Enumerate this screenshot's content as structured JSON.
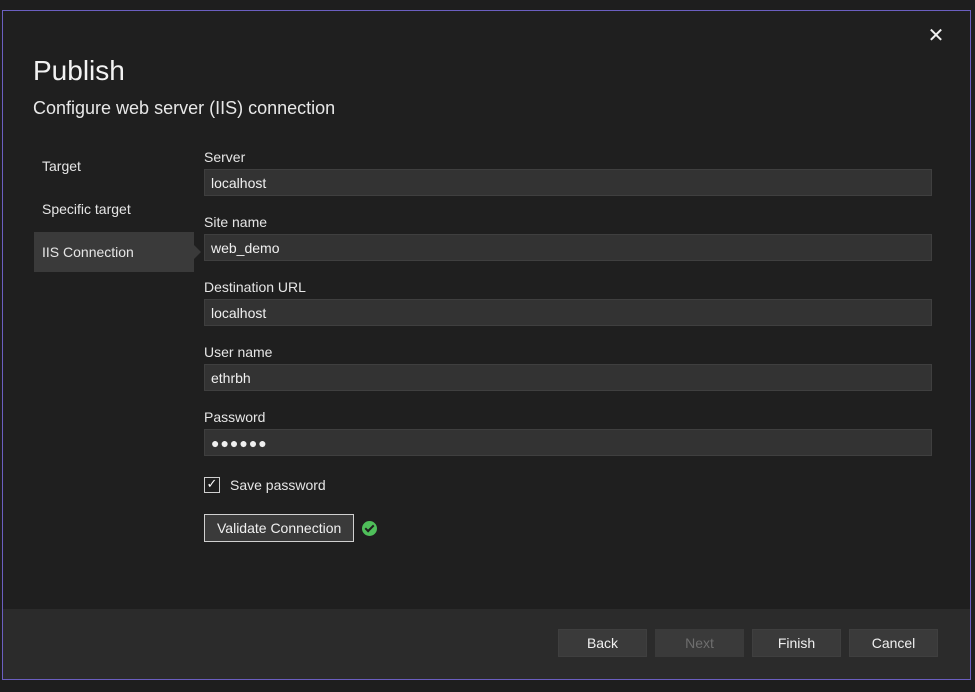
{
  "dialog": {
    "title": "Publish",
    "subtitle": "Configure web server (IIS) connection",
    "close_label": "✕"
  },
  "nav": {
    "items": [
      {
        "label": "Target"
      },
      {
        "label": "Specific target"
      },
      {
        "label": "IIS Connection"
      }
    ],
    "selected": "IIS Connection"
  },
  "form": {
    "server": {
      "label": "Server",
      "value": "localhost"
    },
    "site_name": {
      "label": "Site name",
      "value": "web_demo"
    },
    "destination_url": {
      "label": "Destination URL",
      "value": "localhost"
    },
    "user_name": {
      "label": "User name",
      "value": "ethrbh"
    },
    "password": {
      "label": "Password",
      "value": "●●●●●●"
    },
    "save_password": {
      "label": "Save password",
      "checked": true,
      "check_glyph": "✓"
    },
    "validate_label": "Validate Connection",
    "validate_status_icon": "success-check-icon"
  },
  "footer": {
    "back_label": "Back",
    "next_label": "Next",
    "finish_label": "Finish",
    "cancel_label": "Cancel"
  },
  "colors": {
    "dialog_bg": "#1f1f1f",
    "border_accent": "#6b5fc0",
    "success": "#4fbf5a",
    "footer_bg": "#2b2b2b"
  }
}
